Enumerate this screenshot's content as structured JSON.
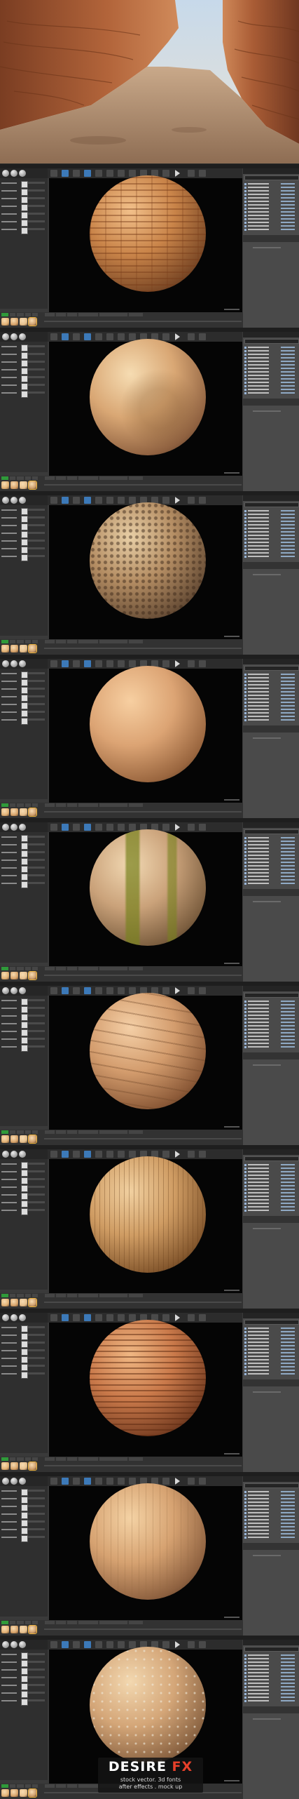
{
  "hero": {
    "description": ""
  },
  "window": {
    "title": ""
  },
  "panels": [
    {
      "sphere_style": "bricks"
    },
    {
      "sphere_style": "sandstone"
    },
    {
      "sphere_style": "rocks"
    },
    {
      "sphere_style": "smooth"
    },
    {
      "sphere_style": "moss"
    },
    {
      "sphere_style": "layered"
    },
    {
      "sphere_style": "wood"
    },
    {
      "sphere_style": "strata"
    },
    {
      "sphere_style": "sand"
    },
    {
      "sphere_style": "pebbles"
    }
  ],
  "watermark": {
    "brand_main": "DESIRE ",
    "brand_accent": "FX",
    "line1": "stock vector. 3d fonts",
    "line2": "after effects . mock up"
  },
  "colors": {
    "accent_blue": "#3c79b8",
    "content_green": "#2f9a3a",
    "selection_orange": "#e8b03c",
    "viewport_bg": "#050505",
    "watermark_accent": "#e8402a"
  }
}
